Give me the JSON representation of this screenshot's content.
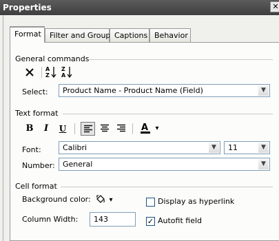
{
  "window": {
    "title": "Properties",
    "close_glyph": "✕"
  },
  "tabs": [
    "Format",
    "Filter and Group",
    "Captions",
    "Behavior"
  ],
  "general": {
    "heading": "General commands",
    "select_label": "Select:",
    "select_value": "Product Name - Product Name (Field)"
  },
  "text_format": {
    "heading": "Text format",
    "bold": "B",
    "italic": "I",
    "underline": "U",
    "font_label": "Font:",
    "font_value": "Calibri",
    "size_value": "11",
    "number_label": "Number:",
    "number_value": "General"
  },
  "cell_format": {
    "heading": "Cell format",
    "bg_label": "Background color:",
    "hyperlink_label": "Display as hyperlink",
    "hyperlink_checked": false,
    "width_label": "Column Width:",
    "width_value": "143",
    "autofit_label": "Autofit field",
    "autofit_checked": true
  },
  "glyphs": {
    "dropdown": "▼",
    "small_dropdown": "▾",
    "check": "✓"
  }
}
